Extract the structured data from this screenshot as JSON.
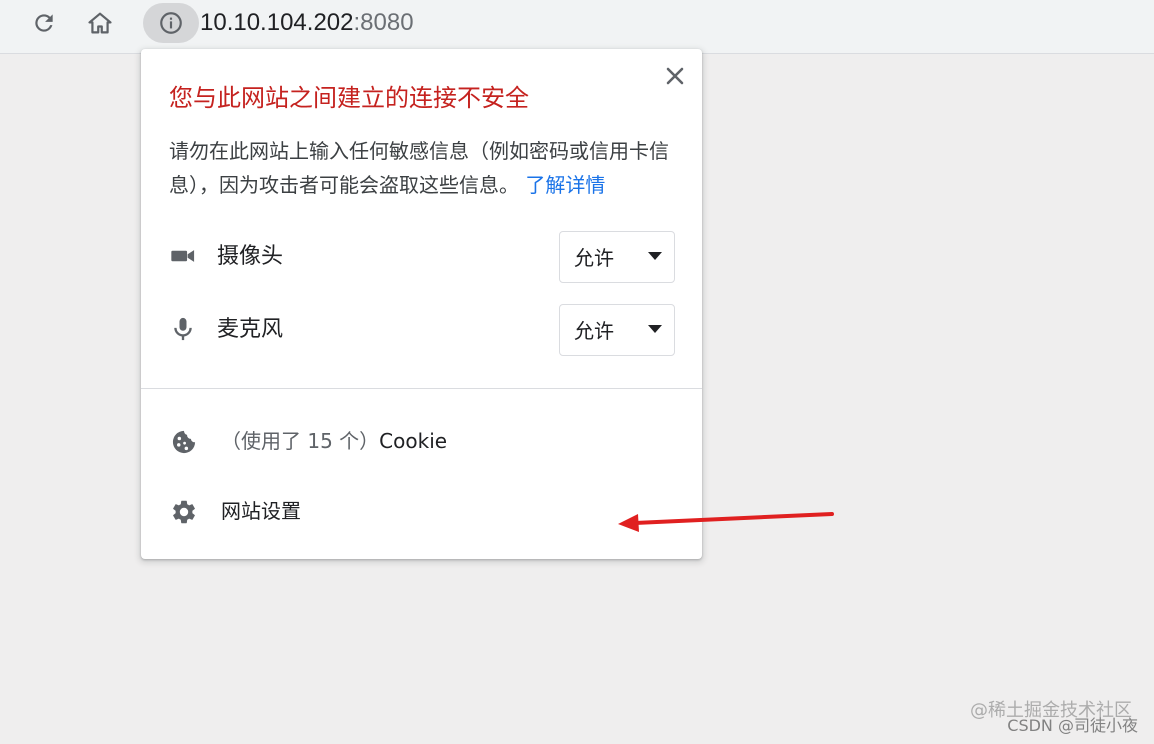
{
  "toolbar": {
    "reload_icon": "reload-icon",
    "home_icon": "home-icon",
    "site_info_icon": "info-icon",
    "url_host": "10.10.104.202",
    "url_port": ":8080"
  },
  "popup": {
    "title": "您与此网站之间建立的连接不安全",
    "description": "请勿在此网站上输入任何敏感信息（例如密码或信用卡信息），因为攻击者可能会盗取这些信息。",
    "learn_more": "了解详情",
    "close_icon": "close-icon",
    "permissions": [
      {
        "icon": "camera-icon",
        "label": "摄像头",
        "value": "允许"
      },
      {
        "icon": "microphone-icon",
        "label": "麦克风",
        "value": "允许"
      }
    ],
    "cookie": {
      "icon": "cookie-icon",
      "count_text": "（使用了 15 个）",
      "label": "Cookie"
    },
    "site_settings": {
      "icon": "gear-icon",
      "label": "网站设置"
    }
  },
  "colors": {
    "warning_title": "#c5221f",
    "link": "#1a73e8",
    "annotation_arrow": "#e02020",
    "page_background": "#efeeee"
  },
  "watermark": {
    "line1": "@稀土掘金技术社区",
    "line2": "CSDN @司徒小夜"
  }
}
